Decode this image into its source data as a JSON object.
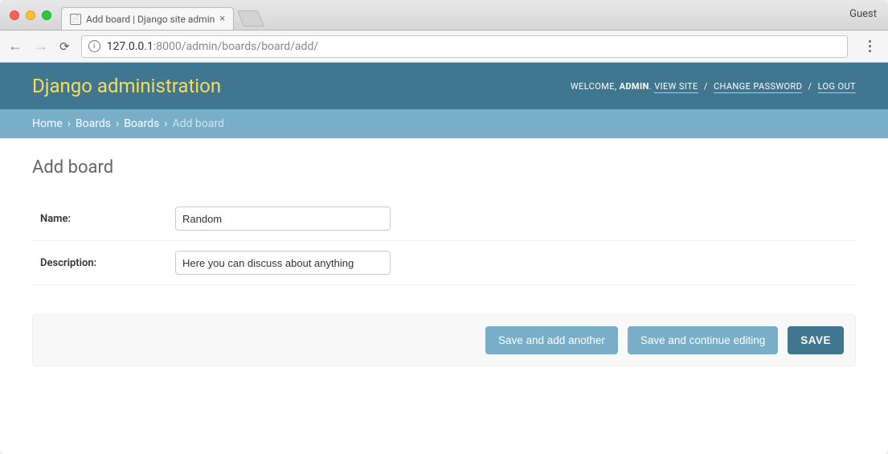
{
  "browser": {
    "tab_title": "Add board | Django site admin",
    "guest_label": "Guest",
    "url_host": "127.0.0.1",
    "url_port_path": ":8000/admin/boards/board/add/"
  },
  "admin": {
    "brand": "Django administration",
    "user_tools": {
      "welcome": "WELCOME,",
      "username": "ADMIN",
      "period": ".",
      "view_site": "VIEW SITE",
      "separator": "/",
      "change_password": "CHANGE PASSWORD",
      "log_out": "LOG OUT"
    },
    "breadcrumbs": {
      "home": "Home",
      "app": "Boards",
      "model": "Boards",
      "current": "Add board",
      "sep": "›"
    },
    "page_title": "Add board",
    "fields": {
      "name_label": "Name:",
      "name_value": "Random",
      "description_label": "Description:",
      "description_value": "Here you can discuss about anything"
    },
    "buttons": {
      "save_add_another": "Save and add another",
      "save_continue": "Save and continue editing",
      "save": "SAVE"
    }
  }
}
